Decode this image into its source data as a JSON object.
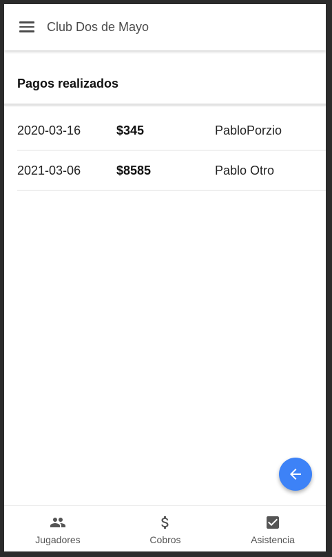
{
  "appbar": {
    "title": "Club Dos de Mayo"
  },
  "section": {
    "title": "Pagos realizados"
  },
  "payments": [
    {
      "date": "2020-03-16",
      "amount": "$345",
      "name": "PabloPorzio"
    },
    {
      "date": "2021-03-06",
      "amount": "$8585",
      "name": "Pablo Otro"
    }
  ],
  "fab": {
    "icon": "arrow-left-icon",
    "color": "#3d82f7"
  },
  "bottom_nav": {
    "items": [
      {
        "label": "Jugadores",
        "icon": "people-icon"
      },
      {
        "label": "Cobros",
        "icon": "dollar-icon"
      },
      {
        "label": "Asistencia",
        "icon": "checkbox-icon"
      }
    ]
  }
}
